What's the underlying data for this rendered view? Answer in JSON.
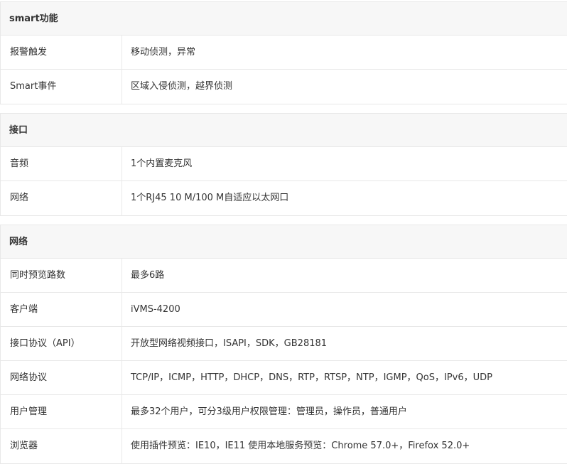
{
  "sections": [
    {
      "title": "smart功能",
      "rows": [
        {
          "label": "报警触发",
          "value": "移动侦测，异常"
        },
        {
          "label": "Smart事件",
          "value": "区域入侵侦测，越界侦测"
        }
      ]
    },
    {
      "title": "接口",
      "rows": [
        {
          "label": "音频",
          "value": "1个内置麦克风"
        },
        {
          "label": "网络",
          "value": "1个RJ45 10 M/100 M自适应以太网口"
        }
      ]
    },
    {
      "title": "网络",
      "rows": [
        {
          "label": "同时预览路数",
          "value": "最多6路"
        },
        {
          "label": "客户端",
          "value": "iVMS-4200"
        },
        {
          "label": "接口协议（API）",
          "value": "开放型网络视频接口，ISAPI，SDK，GB28181"
        },
        {
          "label": "网络协议",
          "value": "TCP/IP，ICMP，HTTP，DHCP，DNS，RTP，RTSP，NTP，IGMP，QoS，IPv6，UDP"
        },
        {
          "label": "用户管理",
          "value": "最多32个用户，可分3级用户权限管理：管理员，操作员，普通用户"
        },
        {
          "label": "浏览器",
          "value": "使用插件预览：IE10，IE11 使用本地服务预览：Chrome 57.0+，Firefox 52.0+"
        }
      ]
    }
  ]
}
